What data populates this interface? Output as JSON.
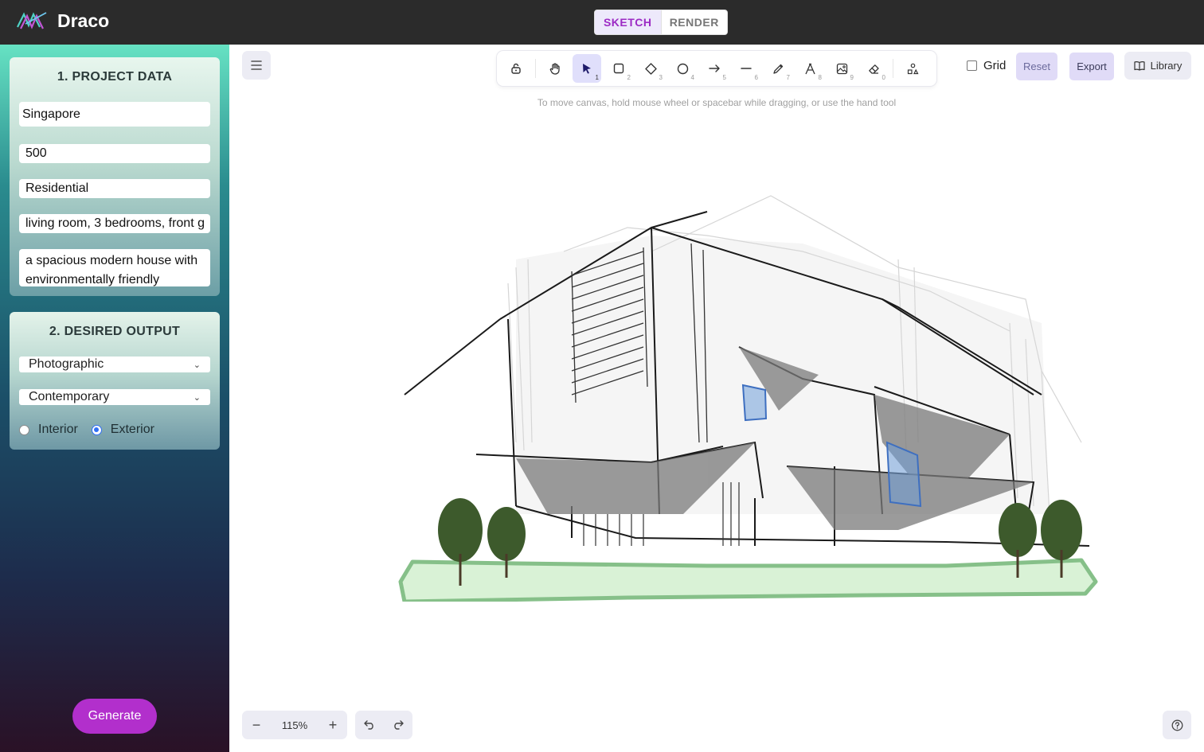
{
  "app": {
    "title": "Draco",
    "logo_icon": "draco-logo-icon"
  },
  "mode_toggle": {
    "options": [
      "SKETCH",
      "RENDER"
    ],
    "selected": "SKETCH"
  },
  "project_data": {
    "title": "1. PROJECT DATA",
    "fields": [
      "Singapore",
      "500",
      "Residential",
      "living room, 3 bedrooms, front g",
      "a spacious modern house with environmentally friendly"
    ]
  },
  "desired_output": {
    "title": "2. DESIRED OUTPUT",
    "selects": [
      "Photographic",
      "Contemporary"
    ],
    "radio_options": [
      "Interior",
      "Exterior"
    ],
    "radio_selected": "Exterior"
  },
  "generate_label": "Generate",
  "toolbar": {
    "tools": [
      {
        "icon": "lock-icon",
        "num": ""
      },
      {
        "icon": "hand-icon",
        "num": ""
      },
      {
        "icon": "selection-arrow-icon",
        "num": "1"
      },
      {
        "icon": "rectangle-icon",
        "num": "2"
      },
      {
        "icon": "diamond-icon",
        "num": "3"
      },
      {
        "icon": "ellipse-icon",
        "num": "4"
      },
      {
        "icon": "arrow-icon",
        "num": "5"
      },
      {
        "icon": "line-icon",
        "num": "6"
      },
      {
        "icon": "pencil-icon",
        "num": "7"
      },
      {
        "icon": "text-icon",
        "num": "8"
      },
      {
        "icon": "image-icon",
        "num": "9"
      },
      {
        "icon": "eraser-icon",
        "num": "0"
      },
      {
        "icon": "shapes-icon",
        "num": ""
      }
    ],
    "active_tool": "selection-arrow-icon"
  },
  "grid": {
    "label": "Grid",
    "checked": false
  },
  "buttons": {
    "reset": "Reset",
    "export": "Export",
    "library": "Library"
  },
  "hint": "To move canvas, hold mouse wheel or spacebar while dragging, or use the hand tool",
  "zoom": {
    "value": "115%",
    "minus": "−",
    "plus": "+"
  },
  "colors": {
    "accent": "#b22fcc",
    "active_tool_bg": "#e0dffb",
    "topbar_bg": "#2b2b2b"
  }
}
